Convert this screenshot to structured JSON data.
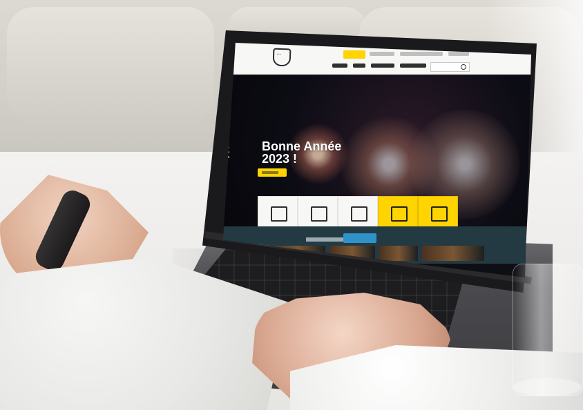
{
  "hero": {
    "title_lines": [
      "Bonne Année",
      "2023 !"
    ]
  }
}
